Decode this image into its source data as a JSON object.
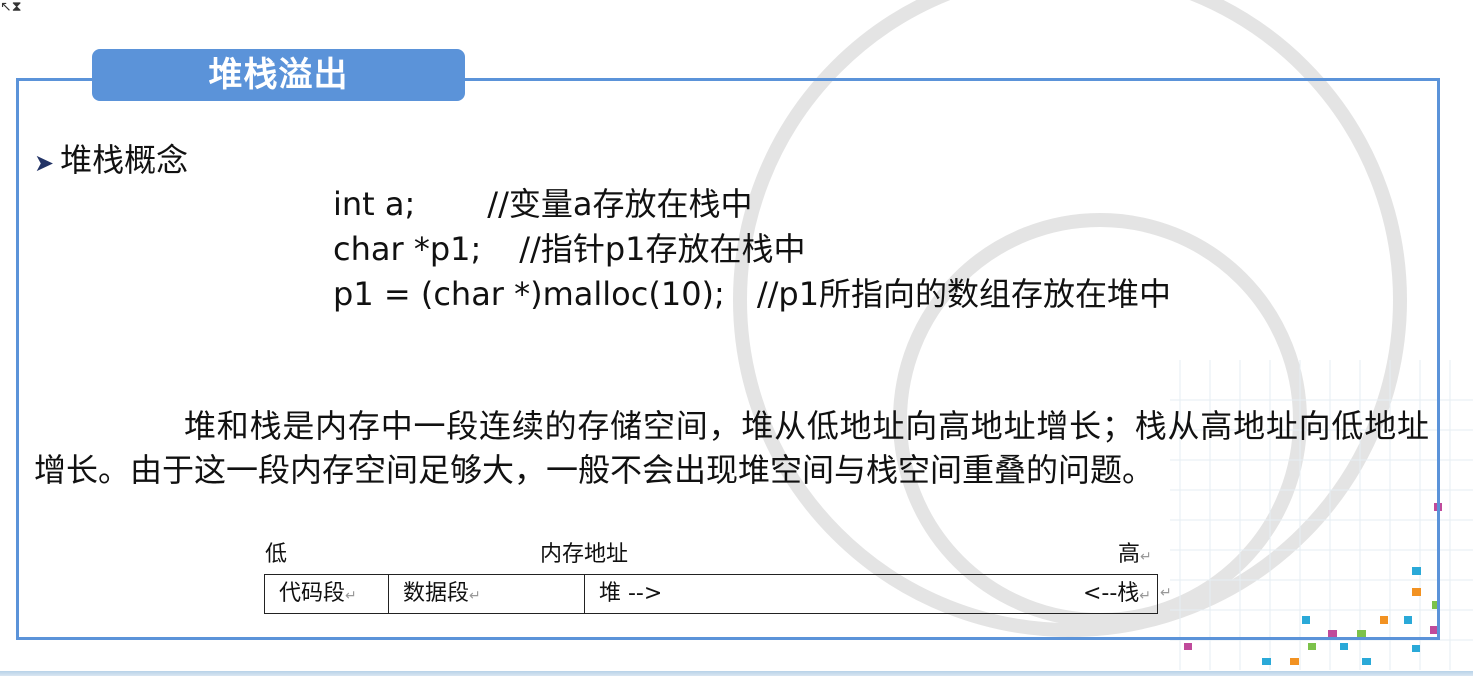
{
  "title": "堆栈溢出",
  "bullet": {
    "icon": "arrow-right-icon",
    "text": "堆栈概念"
  },
  "code": [
    {
      "stmt": "int a;",
      "comment": "//变量a存放在栈中"
    },
    {
      "stmt": "char *p1;",
      "comment": "//指针p1存放在栈中"
    },
    {
      "stmt": "p1 = (char *)malloc(10);",
      "comment": "//p1所指向的数组存放在堆中"
    }
  ],
  "paragraph": "堆和栈是内存中一段连续的存储空间，堆从低地址向高地址增长；栈从高地址向低地址增长。由于这一段内存空间足够大，一般不会出现堆空间与栈空间重叠的问题。",
  "memory_diagram": {
    "label_low": "低",
    "label_mid": "内存地址",
    "label_high": "高",
    "segments": [
      "代码段",
      "数据段"
    ],
    "heap_label": "堆 -->",
    "stack_label": "<--栈"
  },
  "colors": {
    "accent": "#5b93d9"
  }
}
